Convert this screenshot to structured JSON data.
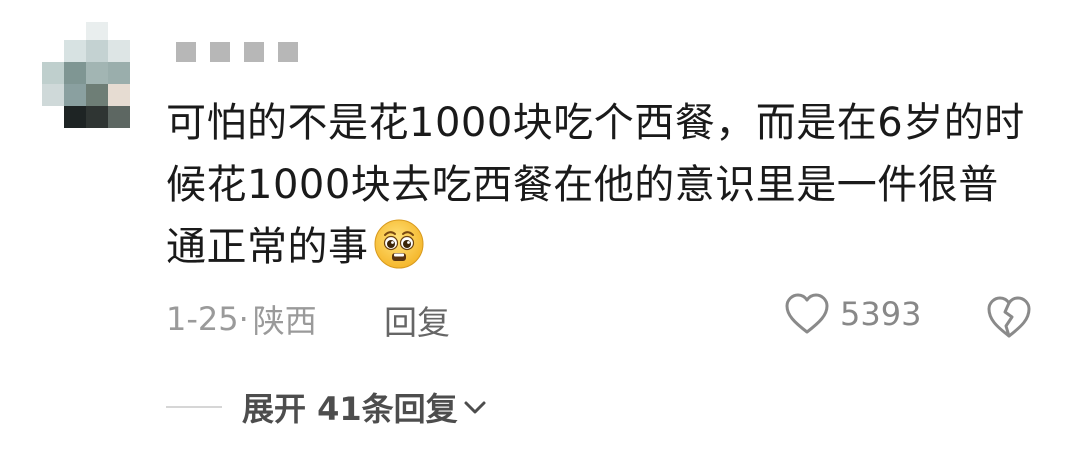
{
  "comment": {
    "lines": [
      "可怕的不是花1000块吃个西餐，而是在6岁的时",
      "候花1000块去吃西餐在他的意识里是一件很普",
      "通正常的事"
    ],
    "emoji": "pleading-face-emoji"
  },
  "meta": {
    "date": "1-25·",
    "location": "陕西",
    "reply_label": "回复"
  },
  "actions": {
    "like_count": "5393",
    "like_icon": "heart-outline-icon",
    "dislike_icon": "broken-heart-icon"
  },
  "replies": {
    "expand_label": "展开 41条回复"
  },
  "colors": {
    "text": "#1a1a1a",
    "meta": "#9a9a9a",
    "username_blur": "#b7b7b7"
  }
}
